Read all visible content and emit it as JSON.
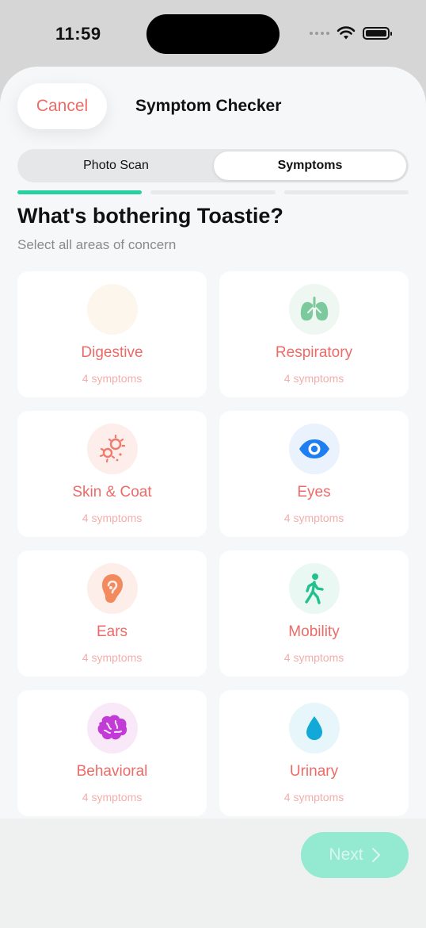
{
  "status": {
    "time": "11:59"
  },
  "header": {
    "cancel_label": "Cancel",
    "title": "Symptom Checker"
  },
  "tabs": [
    {
      "label": "Photo Scan",
      "selected": false
    },
    {
      "label": "Symptoms",
      "selected": true
    }
  ],
  "progress": {
    "steps": 3,
    "current": 1
  },
  "heading": "What's bothering Toastie?",
  "subheading": "Select all areas of concern",
  "categories": [
    {
      "name": "Digestive",
      "count": "4 symptoms",
      "icon": "digestive-icon",
      "bg": "#fdf6ec"
    },
    {
      "name": "Respiratory",
      "count": "4 symptoms",
      "icon": "lungs-icon",
      "bg": "#eef7f1"
    },
    {
      "name": "Skin & Coat",
      "count": "4 symptoms",
      "icon": "bacteria-icon",
      "bg": "#fdeeec"
    },
    {
      "name": "Eyes",
      "count": "4 symptoms",
      "icon": "eye-icon",
      "bg": "#e9f2fd"
    },
    {
      "name": "Ears",
      "count": "4 symptoms",
      "icon": "ear-icon",
      "bg": "#fdeeea"
    },
    {
      "name": "Mobility",
      "count": "4 symptoms",
      "icon": "walking-icon",
      "bg": "#e9f8f2"
    },
    {
      "name": "Behavioral",
      "count": "4 symptoms",
      "icon": "brain-icon",
      "bg": "#f9e9f8"
    },
    {
      "name": "Urinary",
      "count": "4 symptoms",
      "icon": "droplet-icon",
      "bg": "#e7f6fa"
    }
  ],
  "footer": {
    "next_label": "Next"
  },
  "colors": {
    "accent": "#ec6b68",
    "progress": "#26d1a0",
    "next_button": "#94e9d1"
  }
}
